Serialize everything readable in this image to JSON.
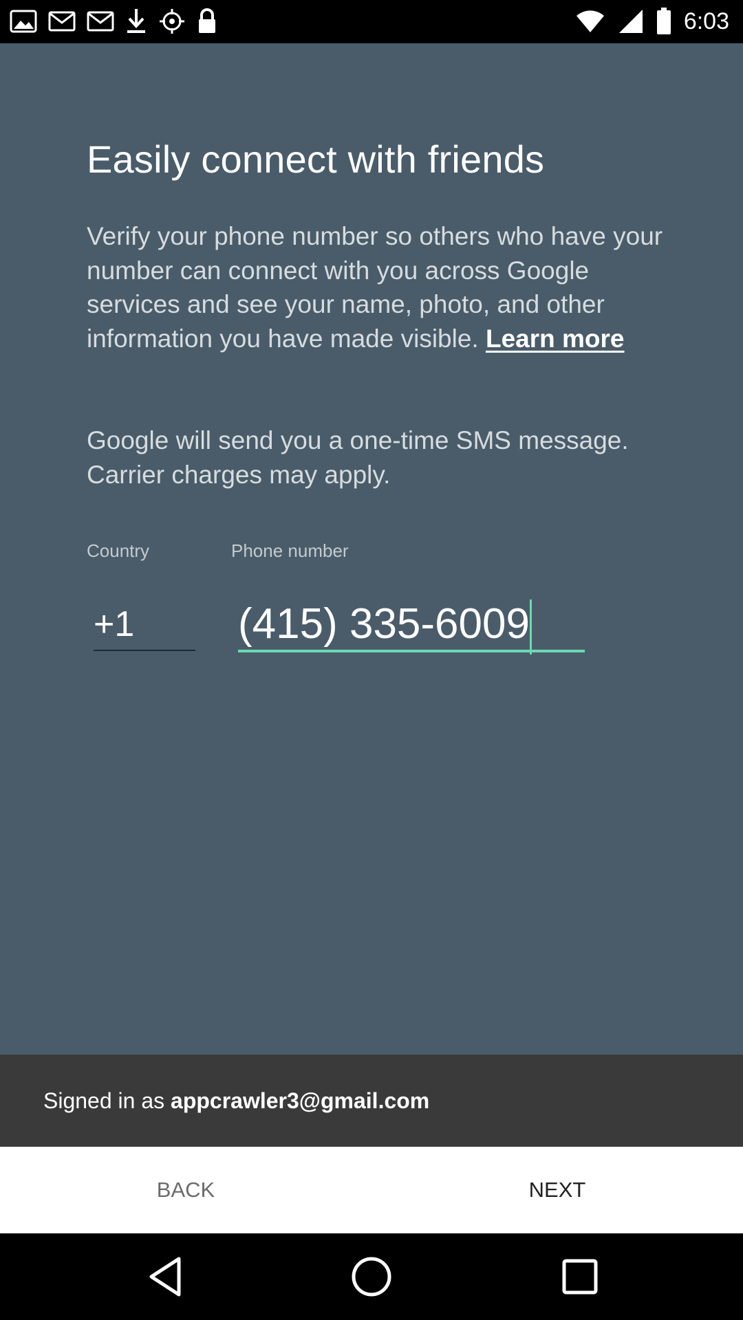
{
  "status_bar": {
    "time": "6:03",
    "icons": [
      "photo-icon",
      "email-icon",
      "download-icon",
      "fake-gps-icon",
      "lock-icon",
      "wifi-icon",
      "signal-icon",
      "battery-icon"
    ]
  },
  "main": {
    "title": "Easily connect with friends",
    "description": "Verify your phone number so others who have your number can connect with you across Google services and see your name, photo, and other information you have made visible.",
    "learn_more": "Learn more",
    "sms_notice": "Google will send you a one-time SMS message. Carrier charges may apply.",
    "country_label": "Country",
    "country_code": "+1",
    "phone_label": "Phone number",
    "phone_value": "(415) 335-6009"
  },
  "signed_in": {
    "prefix": "Signed in as",
    "email": "appcrawler3@gmail.com"
  },
  "buttons": {
    "back": "BACK",
    "next": "NEXT"
  },
  "colors": {
    "background": "#4a5c69",
    "accent": "#6cd9b0",
    "signed_bar": "#3a3a3a"
  }
}
